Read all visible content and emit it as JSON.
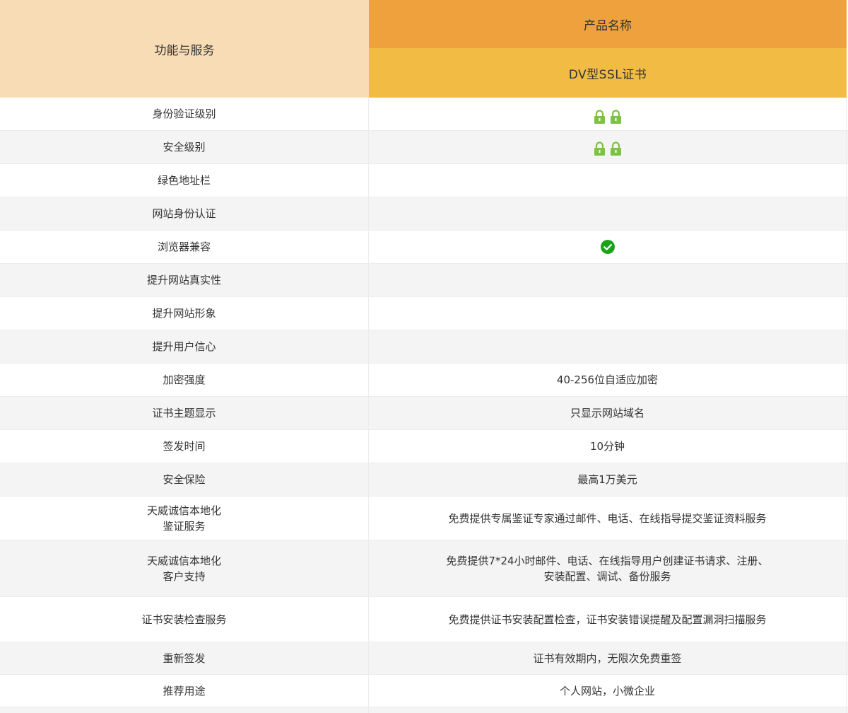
{
  "header": {
    "left_title": "功能与服务",
    "product_title": "产品名称",
    "product_name": "DV型SSL证书"
  },
  "rows": [
    {
      "label": "身份验证级别",
      "value_icon": "lock-icon x2"
    },
    {
      "label": "安全级别",
      "value_icon": "lock-icon x2"
    },
    {
      "label": "绿色地址栏",
      "value": ""
    },
    {
      "label": "网站身份认证",
      "value": ""
    },
    {
      "label": "浏览器兼容",
      "value_icon": "check-circle-icon"
    },
    {
      "label": "提升网站真实性",
      "value": ""
    },
    {
      "label": "提升网站形象",
      "value": ""
    },
    {
      "label": "提升用户信心",
      "value": ""
    },
    {
      "label": "加密强度",
      "value": "40-256位自适应加密"
    },
    {
      "label": "证书主题显示",
      "value": "只显示网站域名"
    },
    {
      "label": "签发时间",
      "value": "10分钟"
    },
    {
      "label": "安全保险",
      "value": "最高1万美元"
    },
    {
      "label_lines": [
        "天威诚信本地化",
        "鉴证服务"
      ],
      "value": "免费提供专属鉴证专家通过邮件、电话、在线指导提交鉴证资料服务"
    },
    {
      "label_lines": [
        "天威诚信本地化",
        "客户支持"
      ],
      "value_lines": [
        "免费提供7*24小时邮件、电话、在线指导用户创建证书请求、注册、",
        "安装配置、调试、备份服务"
      ]
    },
    {
      "label": "证书安装检查服务",
      "value": "免费提供证书安装配置检查，证书安装错误提醒及配置漏洞扫描服务"
    },
    {
      "label": "重新签发",
      "value": "证书有效期内，无限次免费重签"
    },
    {
      "label": "推荐用途",
      "value": "个人网站，小微企业"
    }
  ],
  "colors": {
    "header_left_bg": "#f8dcb6",
    "header_product_bg": "#eea13c",
    "header_name_bg": "#f2bb44",
    "lock_green": "#7dc242",
    "check_green": "#1aa31a",
    "row_alt_bg": "#f4f4f4"
  }
}
